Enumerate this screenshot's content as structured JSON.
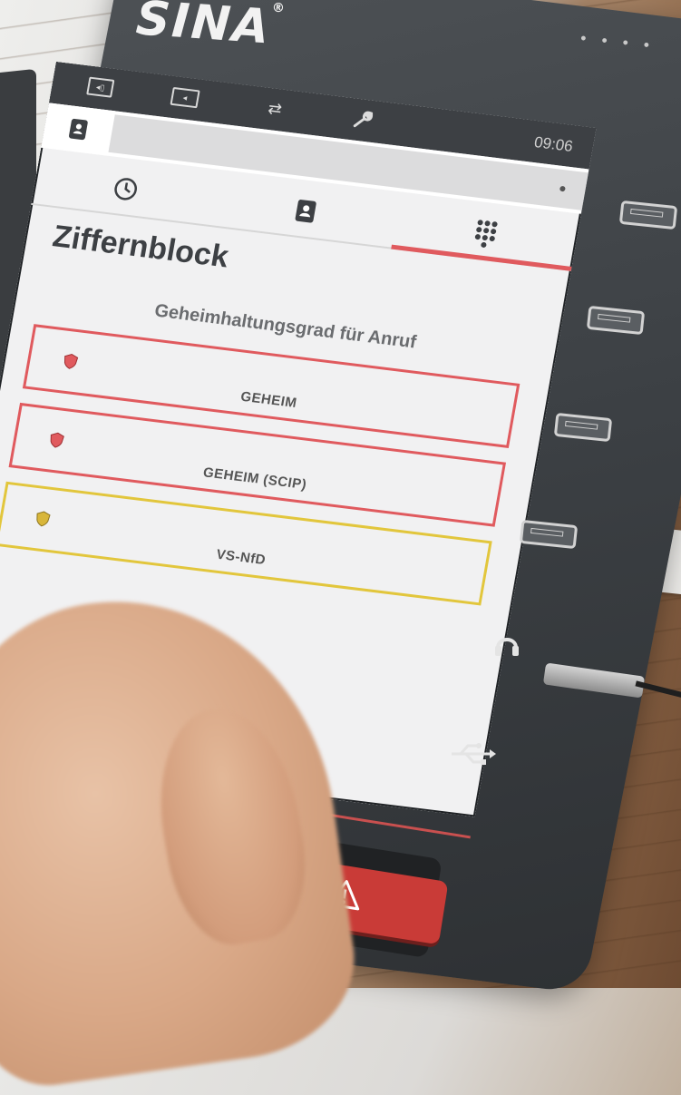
{
  "device": {
    "brand": "SINA"
  },
  "statusbar": {
    "icons": [
      "display-switch-icon",
      "screen-icon",
      "forward-icon",
      "wrench-icon"
    ],
    "time": "09:06"
  },
  "tabs": [
    {
      "name": "history",
      "icon": "clock-icon"
    },
    {
      "name": "contacts",
      "icon": "contacts-icon"
    },
    {
      "name": "keypad",
      "icon": "keypad-icon",
      "active": true
    }
  ],
  "page": {
    "title": "Ziffernblock",
    "subtitle": "Geheimhaltungsgrad für Anruf"
  },
  "classifications": [
    {
      "label": "GEHEIM",
      "color": "#e05a5e"
    },
    {
      "label": "GEHEIM (SCIP)",
      "color": "#e05a5e"
    },
    {
      "label": "VS-NfD",
      "color": "#e2c63c"
    }
  ],
  "colors": {
    "accent": "#e05a5e",
    "warning": "#e2c63c",
    "bezel": "#3c4044"
  }
}
